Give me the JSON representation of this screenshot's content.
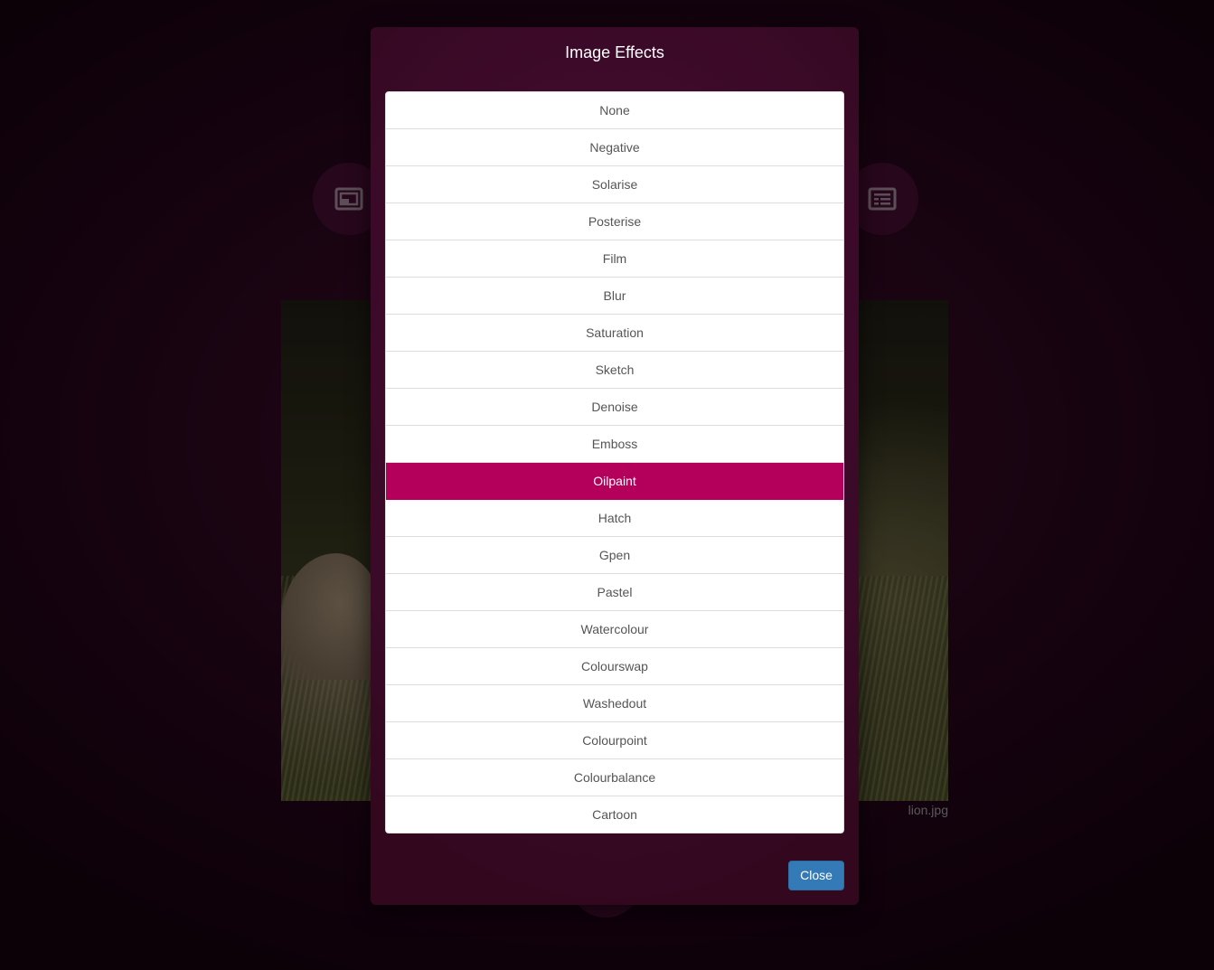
{
  "background": {
    "left_button_icon": "picture-frame-icon",
    "right_button_icon": "text-list-icon",
    "bottom_button_icon": "circle-button",
    "image_caption": "lion.jpg"
  },
  "modal": {
    "title": "Image Effects",
    "effects": [
      "None",
      "Negative",
      "Solarise",
      "Posterise",
      "Film",
      "Blur",
      "Saturation",
      "Sketch",
      "Denoise",
      "Emboss",
      "Oilpaint",
      "Hatch",
      "Gpen",
      "Pastel",
      "Watercolour",
      "Colourswap",
      "Washedout",
      "Colourpoint",
      "Colourbalance",
      "Cartoon"
    ],
    "selected_effect": "Oilpaint",
    "close_label": "Close"
  },
  "colors": {
    "accent": "#b5005b",
    "modal_background": "#3b0a28",
    "close_button": "#337ab7"
  }
}
